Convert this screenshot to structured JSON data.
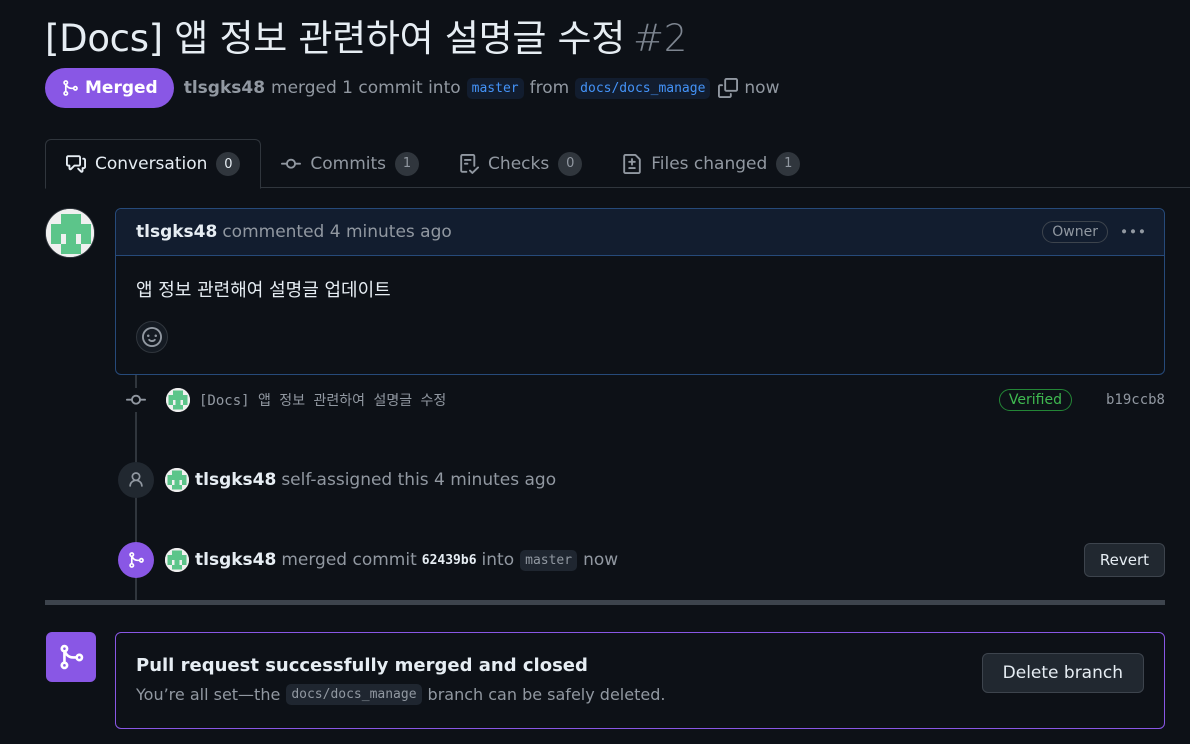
{
  "pr": {
    "title": "[Docs] 앱 정보 관련하여 설명글 수정",
    "number": "#2",
    "state": "Merged",
    "author": "tlsgks48",
    "merged_text": "merged 1 commit into",
    "base_branch": "master",
    "from_text": "from",
    "head_branch": "docs/docs_manage",
    "time": "now"
  },
  "tabs": [
    {
      "label": "Conversation",
      "count": "0"
    },
    {
      "label": "Commits",
      "count": "1"
    },
    {
      "label": "Checks",
      "count": "0"
    },
    {
      "label": "Files changed",
      "count": "1"
    }
  ],
  "comment": {
    "author": "tlsgks48",
    "meta": "commented 4 minutes ago",
    "role": "Owner",
    "body": "앱 정보 관련해여 설명글 업데이트"
  },
  "commit": {
    "message": "[Docs] 앱 정보 관련하여 설명글 수정",
    "verified": "Verified",
    "sha": "b19ccb8"
  },
  "events": {
    "assign": {
      "author": "tlsgks48",
      "text": "self-assigned this 4 minutes ago"
    },
    "merge": {
      "author": "tlsgks48",
      "text": "merged commit",
      "sha": "62439b6",
      "into": "into",
      "branch": "master",
      "time": "now",
      "revert_label": "Revert"
    }
  },
  "merge_box": {
    "title": "Pull request successfully merged and closed",
    "sub_before": "You’re all set—the",
    "branch": "docs/docs_manage",
    "sub_after": "branch can be safely deleted.",
    "delete_label": "Delete branch"
  },
  "colors": {
    "accent_purple": "#8957e5",
    "link_blue": "#4493f8",
    "verified_green": "#3fb950",
    "background": "#0d1117"
  }
}
